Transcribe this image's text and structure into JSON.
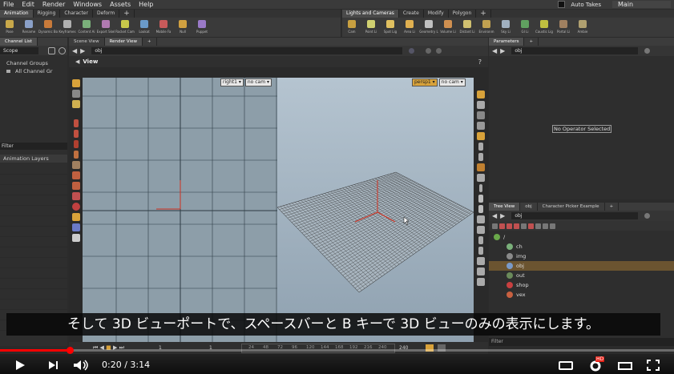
{
  "menubar": {
    "items": [
      "File",
      "Edit",
      "Render",
      "Windows",
      "Assets",
      "Help"
    ],
    "auto_takes": "Auto Takes",
    "desktop": "Main"
  },
  "shelf_left": {
    "tabs": [
      "Animation",
      "Rigging",
      "Character",
      "Deform"
    ],
    "active_tab": "Animation",
    "tools": [
      {
        "label": "Pose",
        "color": "#c8a84a"
      },
      {
        "label": "Rename",
        "color": "#8aa0c8"
      },
      {
        "label": "Dynamic Bo",
        "color": "#c87a3a"
      },
      {
        "label": "Keyframes",
        "color": "#b0b0b0"
      },
      {
        "label": "Content Ai",
        "color": "#7ab07a"
      },
      {
        "label": "Export Skel",
        "color": "#b07ab0"
      },
      {
        "label": "Rocket Cam",
        "color": "#c8c84a"
      },
      {
        "label": "Lookat",
        "color": "#6a9ac8"
      },
      {
        "label": "Mobile Fa",
        "color": "#c85a5a"
      },
      {
        "label": "Null",
        "color": "#d0a040"
      },
      {
        "label": "Puppet",
        "color": "#9a7ac8"
      }
    ]
  },
  "shelf_right": {
    "tabs": [
      "Lights and Cameras",
      "Create",
      "Modify",
      "Polygon"
    ],
    "active_tab": "Lights and Cameras",
    "tools": [
      {
        "label": "Cam",
        "color": "#c8a040"
      },
      {
        "label": "Point Li",
        "color": "#d0d070"
      },
      {
        "label": "Spot Lig",
        "color": "#e0c060"
      },
      {
        "label": "Area Li",
        "color": "#e0b050"
      },
      {
        "label": "Geometry L",
        "color": "#c0c0c0"
      },
      {
        "label": "Volume Li",
        "color": "#d09050"
      },
      {
        "label": "Distant Li",
        "color": "#d0c070"
      },
      {
        "label": "Environm",
        "color": "#c0a050"
      },
      {
        "label": "Sky Li",
        "color": "#a0b0c0"
      },
      {
        "label": "GI Li",
        "color": "#60a060"
      },
      {
        "label": "Caustic Lig",
        "color": "#c0c040"
      },
      {
        "label": "Portal Li",
        "color": "#a08060"
      },
      {
        "label": "Ambie",
        "color": "#b0a070"
      }
    ]
  },
  "channel_panel": {
    "tab": "Channel List",
    "scope_label": "Scope",
    "channel_groups": "Channel Groups",
    "all_channels": "All Channel Gr",
    "filter_label": "Filter",
    "anim_layers": "Animation Layers"
  },
  "scene_view": {
    "tabs": [
      "Scene View",
      "Render View"
    ],
    "path": "obj",
    "view_title": "View",
    "left_view": {
      "camera": "right1",
      "cam_menu": "no cam"
    },
    "right_view": {
      "camera": "persp1",
      "cam_menu": "no cam"
    }
  },
  "parameters": {
    "tab": "Parameters",
    "path": "obj",
    "empty_message": "No Operator Selected"
  },
  "network": {
    "tabs": [
      "Tree View",
      "obj",
      "Character Picker Example"
    ],
    "path": "obj",
    "nodes": [
      {
        "label": "/",
        "color": "#6aa84a",
        "selected": false
      },
      {
        "label": "ch",
        "color": "#7ab07a",
        "selected": false
      },
      {
        "label": "img",
        "color": "#8a8a8a",
        "selected": false
      },
      {
        "label": "obj",
        "color": "#7a9ac8",
        "selected": true
      },
      {
        "label": "out",
        "color": "#6a8a5a",
        "selected": false
      },
      {
        "label": "shop",
        "color": "#c84040",
        "selected": false
      },
      {
        "label": "vex",
        "color": "#c86040",
        "selected": false
      }
    ],
    "filter_label": "Filter"
  },
  "timeline": {
    "ticks": [
      "24",
      "48",
      "72",
      "96",
      "120",
      "144",
      "168",
      "192",
      "216",
      "240"
    ],
    "start": "1",
    "current": "1",
    "end": "240"
  },
  "caption": {
    "text": "そして 3D ビューポートで、スペースバーと B キーで 3D ビューのみの表示にします。"
  },
  "player": {
    "time": "0:20 / 3:14",
    "progress": 0.103,
    "hd_badge": "HD"
  },
  "colors": {
    "accent": "#ff0000",
    "houdini_orange": "#d8a23a",
    "selection": "#6b5430"
  }
}
